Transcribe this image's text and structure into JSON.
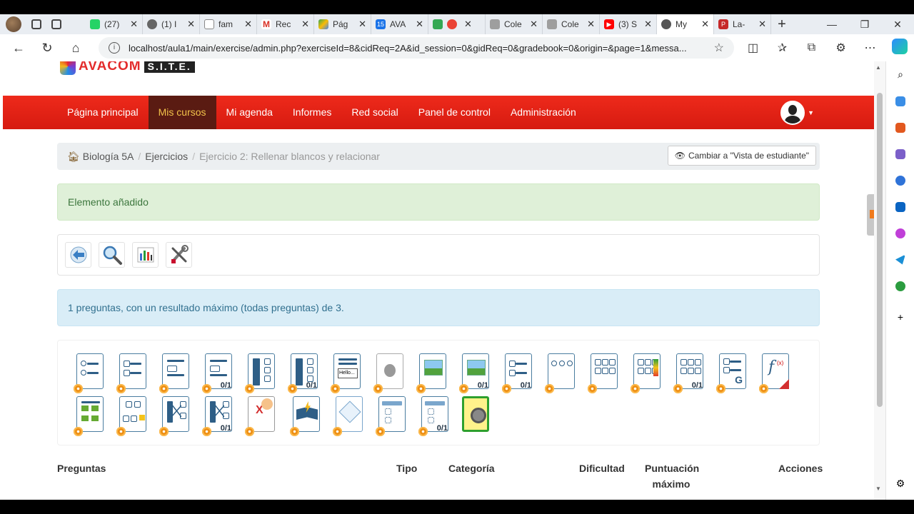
{
  "browser": {
    "tabs": [
      {
        "label": "(27)",
        "color": "#25d366"
      },
      {
        "label": "(1) I",
        "color": "#666666"
      },
      {
        "label": "fam",
        "color": "#888888"
      },
      {
        "label": "Rec",
        "color": "#d93025"
      },
      {
        "label": "Pág",
        "color": "#34a853"
      },
      {
        "label": "AVA",
        "color": "#1a73e8"
      },
      {
        "label": "",
        "color": "#ea4335"
      },
      {
        "label": "Cole",
        "color": "#9e9e9e"
      },
      {
        "label": "Cole",
        "color": "#9e9e9e"
      },
      {
        "label": "(3) S",
        "color": "#ff0000"
      },
      {
        "label": "My",
        "color": "#555555"
      },
      {
        "label": "La-",
        "color": "#c62828"
      }
    ],
    "url": "localhost/aula1/main/exercise/admin.php?exerciseId=8&cidReq=2A&id_session=0&gidReq=0&gradebook=0&origin=&page=1&messa..."
  },
  "site": {
    "brand": "AVACOM",
    "brand_suffix": "S.I.T.E."
  },
  "nav": {
    "items": [
      "Página principal",
      "Mis cursos",
      "Mi agenda",
      "Informes",
      "Red social",
      "Panel de control",
      "Administración"
    ],
    "active": "Mis cursos"
  },
  "breadcrumb": {
    "course": "Biología 5A",
    "section": "Ejercicios",
    "current": "Ejercicio 2: Rellenar blancos y relacionar",
    "student_view_button": "Cambiar a \"Vista de estudiante\""
  },
  "messages": {
    "success": "Elemento añadido",
    "info": "1 preguntas, con un resultado máximo (todas preguntas) de 3."
  },
  "toolbar": {
    "buttons": [
      "back-icon",
      "preview-icon",
      "results-chart-icon",
      "settings-tools-icon"
    ]
  },
  "question_types": {
    "fraction_label": "0/1",
    "hello_label": "Hello..."
  },
  "table": {
    "headers": [
      "Preguntas",
      "Tipo",
      "Categoría",
      "Dificultad",
      "Puntuación",
      "máximo",
      "Acciones"
    ]
  },
  "colors": {
    "nav_red": "#e62117",
    "nav_active_bg": "#5a1b12",
    "nav_active_text": "#f3c34a",
    "success_bg": "#dff0d8",
    "info_bg": "#d9edf7"
  }
}
